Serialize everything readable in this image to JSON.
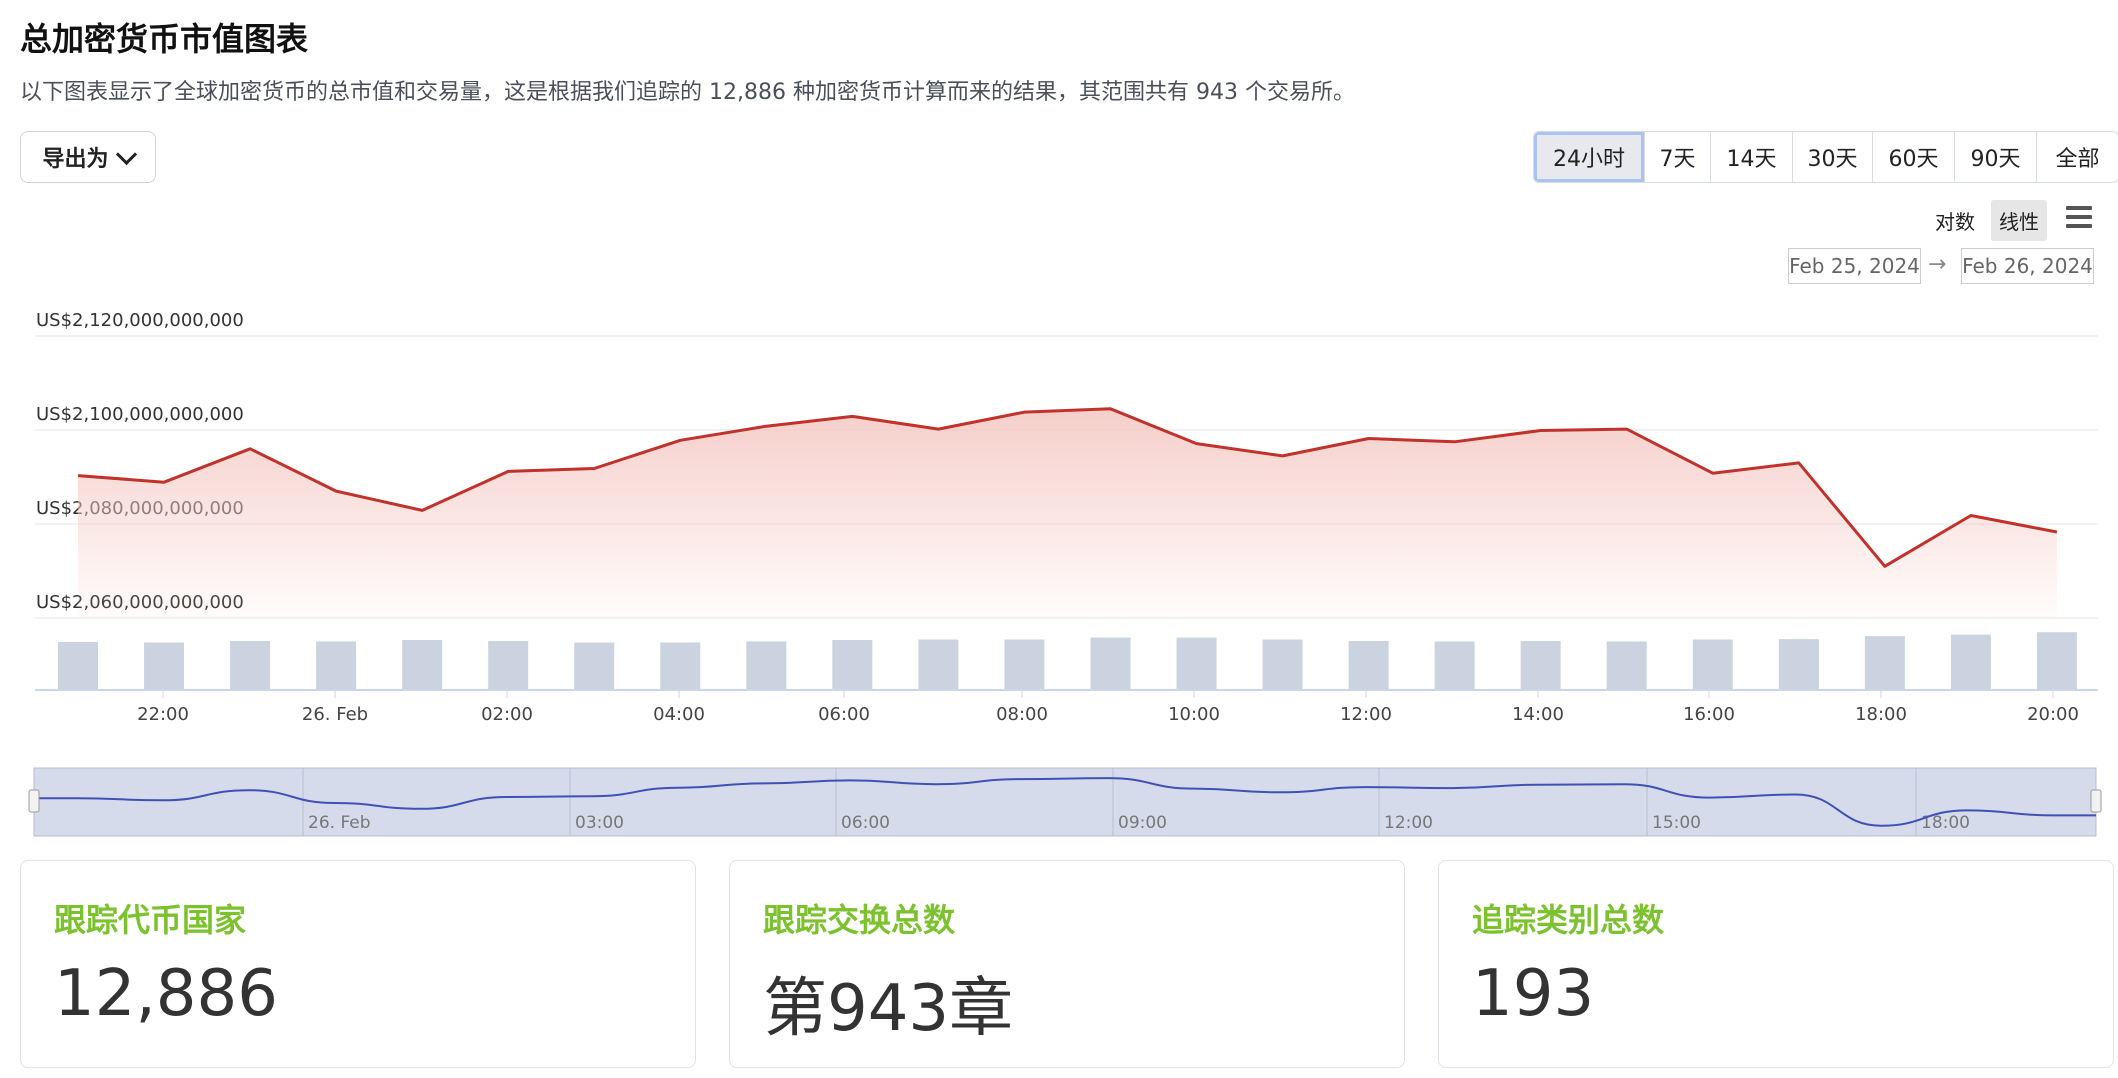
{
  "header": {
    "title": "总加密货币市值图表",
    "subtitle": "以下图表显示了全球加密货币的总市值和交易量，这是根据我们追踪的 12,886 种加密货币计算而来的结果，其范围共有 943 个交易所。"
  },
  "toolbar": {
    "export_label": "导出为",
    "ranges": [
      "24小时",
      "7天",
      "14天",
      "30天",
      "60天",
      "90天",
      "全部"
    ],
    "active_range": "24小时",
    "scale_options": [
      "对数",
      "线性"
    ],
    "active_scale": "线性",
    "date_from": "Feb 25, 2024",
    "date_to": "Feb 26, 2024",
    "date_arrow": "→"
  },
  "chart_data": {
    "type": "area",
    "y_ticks": [
      "US$2,120,000,000,000",
      "US$2,100,000,000,000",
      "US$2,080,000,000,000",
      "US$2,060,000,000,000"
    ],
    "y_tick_values": [
      2120,
      2100,
      2080,
      2060
    ],
    "y_unit": "billion USD",
    "ylim": [
      2060,
      2120
    ],
    "x_ticks": [
      "22:00",
      "26. Feb",
      "02:00",
      "04:00",
      "06:00",
      "08:00",
      "10:00",
      "12:00",
      "14:00",
      "16:00",
      "18:00",
      "20:00"
    ],
    "x_hours": [
      0.5,
      1.5,
      2.5,
      3.5,
      4.5,
      5.5,
      6.5,
      7.5,
      8.5,
      9.5,
      10.5,
      11.5,
      12.5,
      13.5,
      14.5,
      15.5,
      16.5,
      17.5,
      18.5,
      19.5,
      20.5,
      21.5,
      22.5,
      23.5
    ],
    "market_cap": [
      2090.3,
      2088.9,
      2096.0,
      2087.0,
      2082.9,
      2091.2,
      2091.8,
      2097.8,
      2100.8,
      2102.9,
      2100.2,
      2103.8,
      2104.5,
      2097.1,
      2094.5,
      2098.2,
      2097.5,
      2099.9,
      2100.2,
      2090.8,
      2093.0,
      2071.0,
      2081.8,
      2078.3
    ],
    "volume_relative": [
      0.98,
      0.97,
      1.0,
      0.99,
      1.02,
      1.0,
      0.97,
      0.97,
      0.99,
      1.02,
      1.03,
      1.03,
      1.07,
      1.07,
      1.03,
      1.0,
      0.99,
      1.0,
      0.99,
      1.03,
      1.04,
      1.1,
      1.13,
      1.18
    ],
    "navigator_ticks": [
      "26. Feb",
      "03:00",
      "06:00",
      "09:00",
      "12:00",
      "15:00",
      "18:00"
    ],
    "line_color": "#c0322b",
    "fill_color": "#f4c9c4",
    "volume_color": "#ccd3e0",
    "navigator_line_color": "#3f51b5",
    "grid": true
  },
  "stats": [
    {
      "label": "跟踪代币国家",
      "value": "12,886"
    },
    {
      "label": "跟踪交换总数",
      "value": "第943章"
    },
    {
      "label": "追踪类别总数",
      "value": "193"
    }
  ]
}
